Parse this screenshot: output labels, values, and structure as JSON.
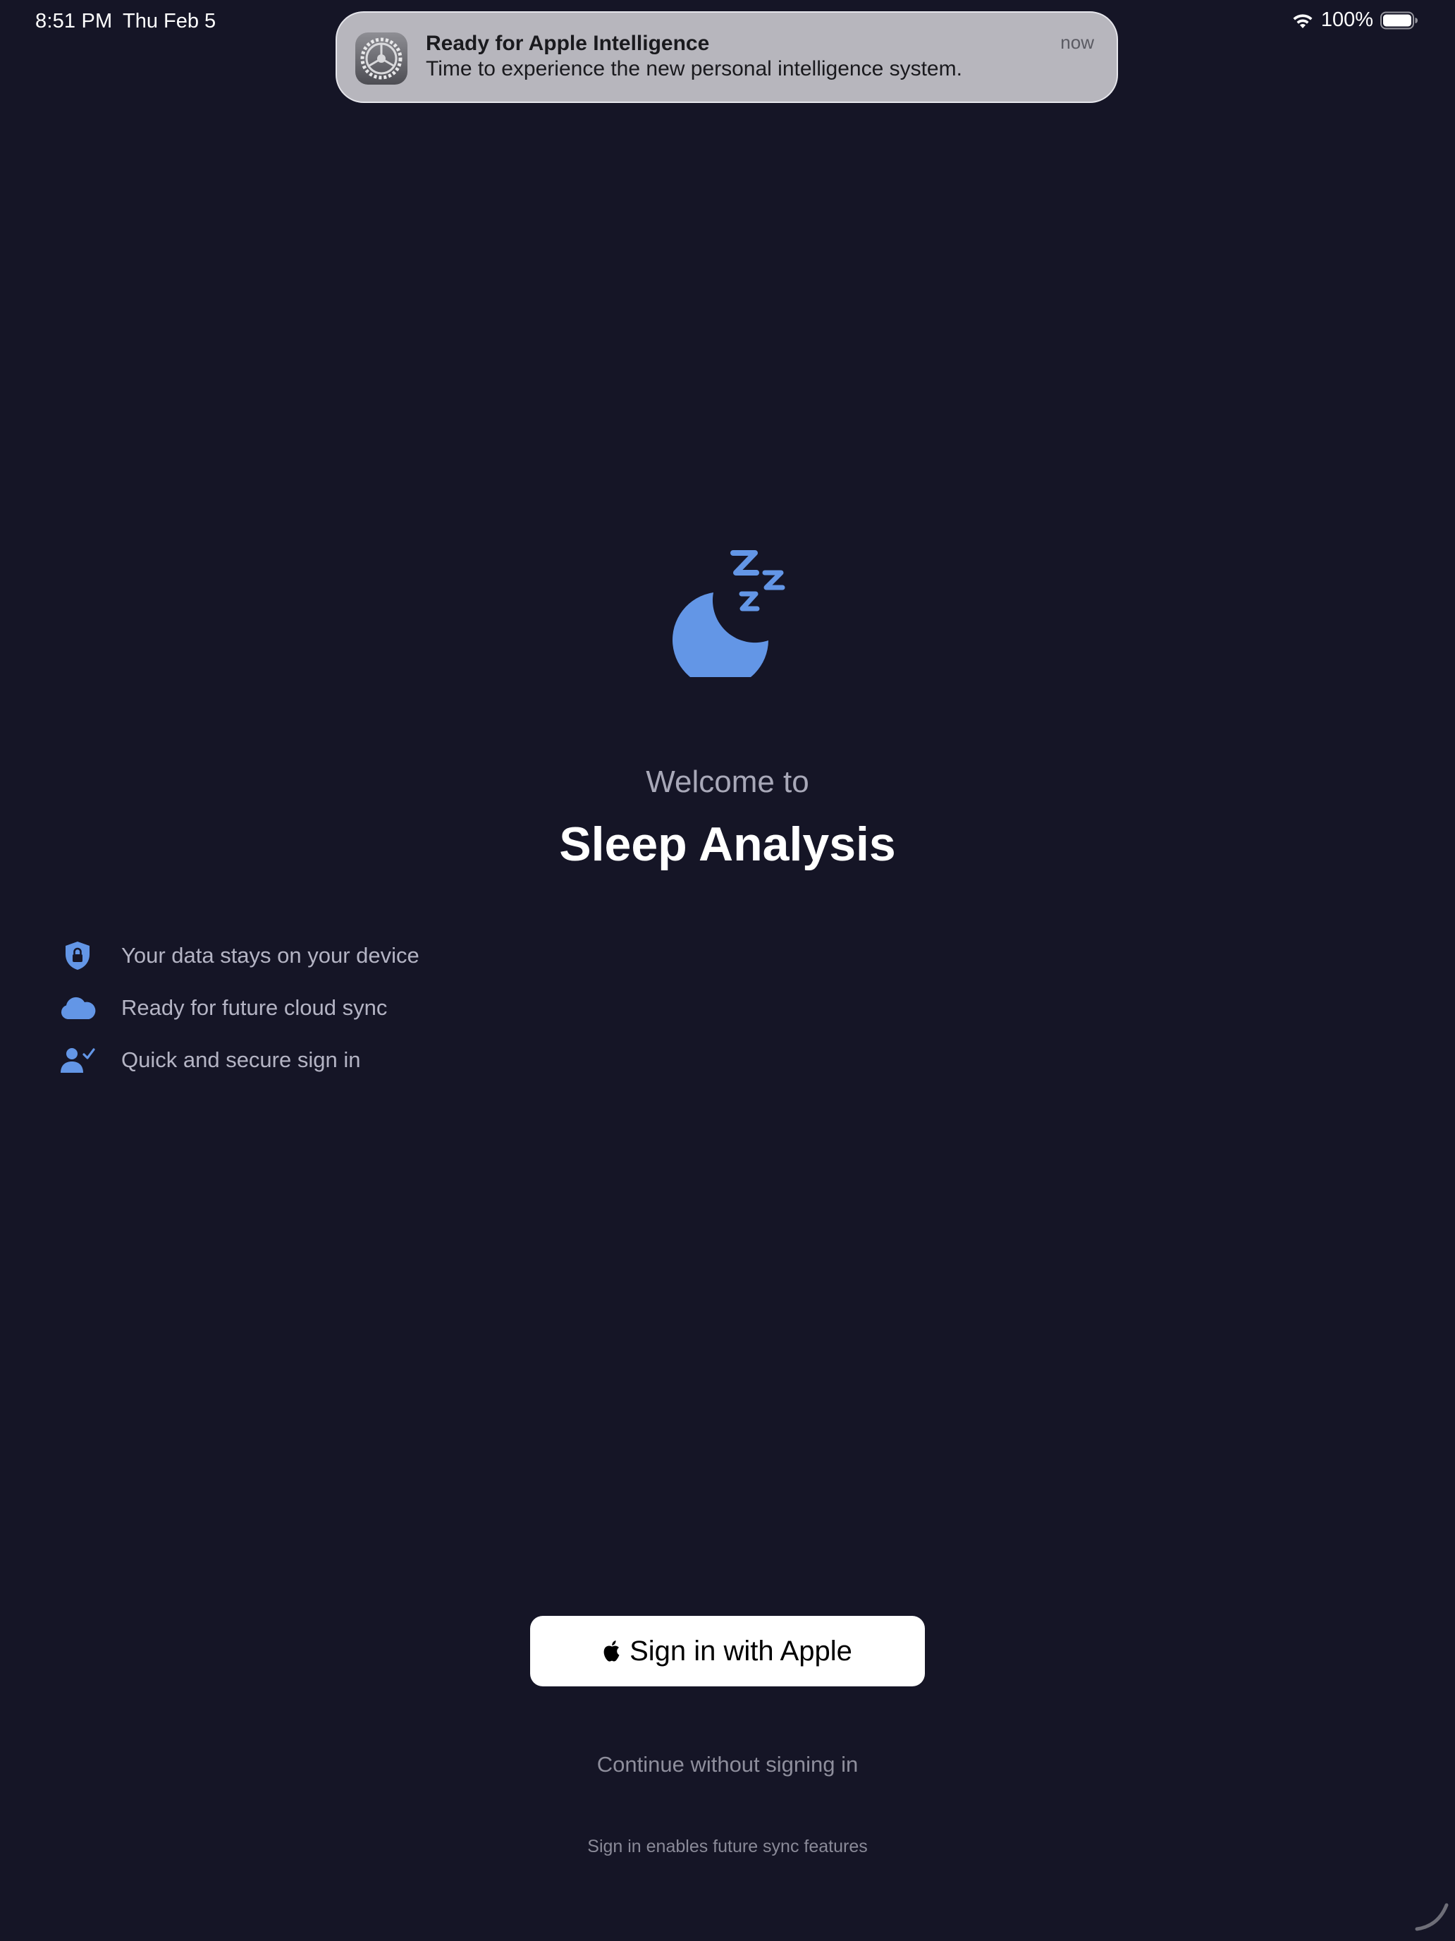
{
  "status_bar": {
    "time": "8:51 PM",
    "date": "Thu Feb 5",
    "battery_percent": "100%",
    "icons": [
      "wifi-icon",
      "battery-icon"
    ]
  },
  "notification": {
    "app_icon": "settings-gear-icon",
    "title": "Ready for Apple Intelligence",
    "body": "Time to experience the new personal intelligence system.",
    "time": "now"
  },
  "hero": {
    "icon": "moon-zzz-icon",
    "welcome": "Welcome to",
    "title": "Sleep Analysis"
  },
  "features": [
    {
      "icon": "lock-shield-icon",
      "label": "Your data stays on your device"
    },
    {
      "icon": "cloud-icon",
      "label": "Ready for future cloud sync"
    },
    {
      "icon": "person-checkmark-icon",
      "label": "Quick and secure sign in"
    }
  ],
  "actions": {
    "sign_in_apple": "Sign in with Apple",
    "continue_without": "Continue without signing in",
    "footnote": "Sign in enables future sync features"
  },
  "colors": {
    "background": "#151526",
    "accent": "#6396e6",
    "button_bg": "#ffffff"
  }
}
